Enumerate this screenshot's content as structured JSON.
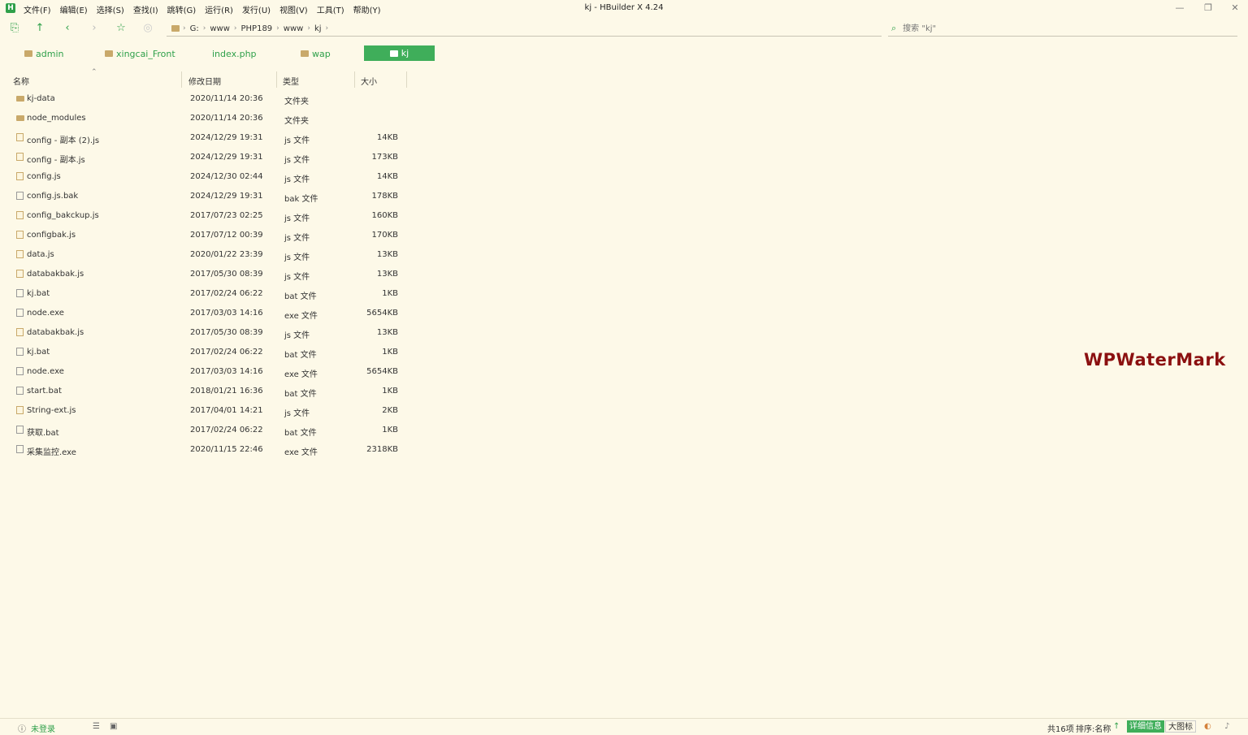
{
  "app": {
    "logo": "H",
    "window_title": "kj - HBuilder X 4.24"
  },
  "menu": [
    "文件(F)",
    "编辑(E)",
    "选择(S)",
    "查找(I)",
    "跳转(G)",
    "运行(R)",
    "发行(U)",
    "视图(V)",
    "工具(T)",
    "帮助(Y)"
  ],
  "window_controls": {
    "minimize": "—",
    "restore": "❐",
    "close": "✕"
  },
  "toolbar": {
    "icons": [
      "new-window-icon",
      "up-arrow-icon",
      "back-icon",
      "forward-icon",
      "favorite-star-icon",
      "circle-play-icon"
    ],
    "breadcrumb": [
      "G:",
      "www",
      "PHP189",
      "www",
      "kj"
    ],
    "search_placeholder": "搜索 \"kj\""
  },
  "quick_folders": [
    {
      "label": "admin",
      "type": "folder"
    },
    {
      "label": "xingcai_Front",
      "type": "folder"
    },
    {
      "label": "index.php",
      "type": "file"
    },
    {
      "label": "wap",
      "type": "folder"
    },
    {
      "label": "kj",
      "type": "folder",
      "active": true
    }
  ],
  "columns": {
    "name": "名称",
    "date": "修改日期",
    "type": "类型",
    "size": "大小"
  },
  "files": [
    {
      "name": "kj-data",
      "date": "2020/11/14 20:36",
      "type": "文件夹",
      "size": "",
      "icon": "folder"
    },
    {
      "name": "node_modules",
      "date": "2020/11/14 20:36",
      "type": "文件夹",
      "size": "",
      "icon": "folder"
    },
    {
      "name": "config - 副本 (2).js",
      "date": "2024/12/29 19:31",
      "type": "js 文件",
      "size": "14KB",
      "icon": "jsfile"
    },
    {
      "name": "config - 副本.js",
      "date": "2024/12/29 19:31",
      "type": "js 文件",
      "size": "173KB",
      "icon": "jsfile"
    },
    {
      "name": "config.js",
      "date": "2024/12/30 02:44",
      "type": "js 文件",
      "size": "14KB",
      "icon": "jsfile"
    },
    {
      "name": "config.js.bak",
      "date": "2024/12/29 19:31",
      "type": "bak 文件",
      "size": "178KB",
      "icon": "file"
    },
    {
      "name": "config_bakckup.js",
      "date": "2017/07/23 02:25",
      "type": "js 文件",
      "size": "160KB",
      "icon": "jsfile"
    },
    {
      "name": "configbak.js",
      "date": "2017/07/12 00:39",
      "type": "js 文件",
      "size": "170KB",
      "icon": "jsfile"
    },
    {
      "name": "data.js",
      "date": "2020/01/22 23:39",
      "type": "js 文件",
      "size": "13KB",
      "icon": "jsfile"
    },
    {
      "name": "databakbak.js",
      "date": "2017/05/30 08:39",
      "type": "js 文件",
      "size": "13KB",
      "icon": "jsfile"
    },
    {
      "name": "kj.bat",
      "date": "2017/02/24 06:22",
      "type": "bat 文件",
      "size": "1KB",
      "icon": "file"
    },
    {
      "name": "node.exe",
      "date": "2017/03/03 14:16",
      "type": "exe 文件",
      "size": "5654KB",
      "icon": "file"
    },
    {
      "name": "databakbak.js",
      "date": "2017/05/30 08:39",
      "type": "js 文件",
      "size": "13KB",
      "icon": "jsfile"
    },
    {
      "name": "kj.bat",
      "date": "2017/02/24 06:22",
      "type": "bat 文件",
      "size": "1KB",
      "icon": "file"
    },
    {
      "name": "node.exe",
      "date": "2017/03/03 14:16",
      "type": "exe 文件",
      "size": "5654KB",
      "icon": "file"
    },
    {
      "name": "start.bat",
      "date": "2018/01/21 16:36",
      "type": "bat 文件",
      "size": "1KB",
      "icon": "file"
    },
    {
      "name": "String-ext.js",
      "date": "2017/04/01 14:21",
      "type": "js 文件",
      "size": "2KB",
      "icon": "jsfile"
    },
    {
      "name": "获取.bat",
      "date": "2017/02/24 06:22",
      "type": "bat 文件",
      "size": "1KB",
      "icon": "file"
    },
    {
      "name": "采集监控.exe",
      "date": "2020/11/15 22:46",
      "type": "exe 文件",
      "size": "2318KB",
      "icon": "file"
    }
  ],
  "watermark": "WPWaterMark",
  "statusbar": {
    "login": "未登录",
    "count": "共16项",
    "sort": "排序:名称",
    "detail_btn": "详细信息",
    "largeicon_btn": "大图标"
  },
  "colors": {
    "accent": "#3fae5a",
    "background": "#fdf9e8",
    "folder": "#c9a96a",
    "watermark": "#8b1010"
  }
}
